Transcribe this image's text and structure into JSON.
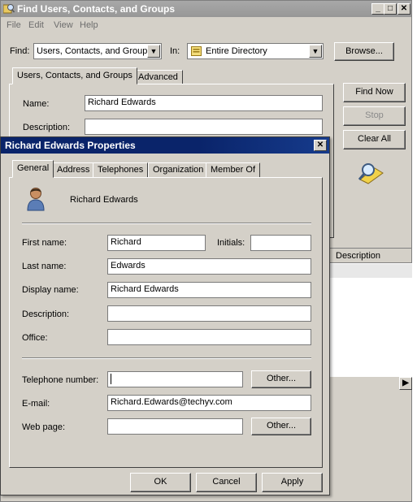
{
  "find_window": {
    "title": "Find Users, Contacts, and Groups",
    "menu": [
      "File",
      "Edit",
      "View",
      "Help"
    ],
    "find_label": "Find:",
    "find_value": "Users, Contacts, and Groups",
    "in_label": "In:",
    "in_value": "Entire Directory",
    "browse_label": "Browse...",
    "tabs": [
      "Users, Contacts, and Groups",
      "Advanced"
    ],
    "name_label": "Name:",
    "name_value": "Richard Edwards",
    "description_label": "Description:",
    "description_value": "",
    "find_now_label": "Find Now",
    "stop_label": "Stop",
    "clear_all_label": "Clear All",
    "results_column": "Description"
  },
  "props_dialog": {
    "title": "Richard Edwards Properties",
    "tabs": [
      "General",
      "Address",
      "Telephones",
      "Organization",
      "Member Of"
    ],
    "display_heading": "Richard Edwards",
    "first_name_label": "First name:",
    "first_name_value": "Richard",
    "initials_label": "Initials:",
    "initials_value": "",
    "last_name_label": "Last name:",
    "last_name_value": "Edwards",
    "display_name_label": "Display name:",
    "display_name_value": "Richard Edwards",
    "description_label": "Description:",
    "description_value": "",
    "office_label": "Office:",
    "office_value": "",
    "telephone_label": "Telephone number:",
    "telephone_value": "",
    "other_label": "Other...",
    "email_label": "E-mail:",
    "email_value": "Richard.Edwards@techyv.com",
    "webpage_label": "Web page:",
    "webpage_value": "",
    "ok_label": "OK",
    "cancel_label": "Cancel",
    "apply_label": "Apply"
  }
}
